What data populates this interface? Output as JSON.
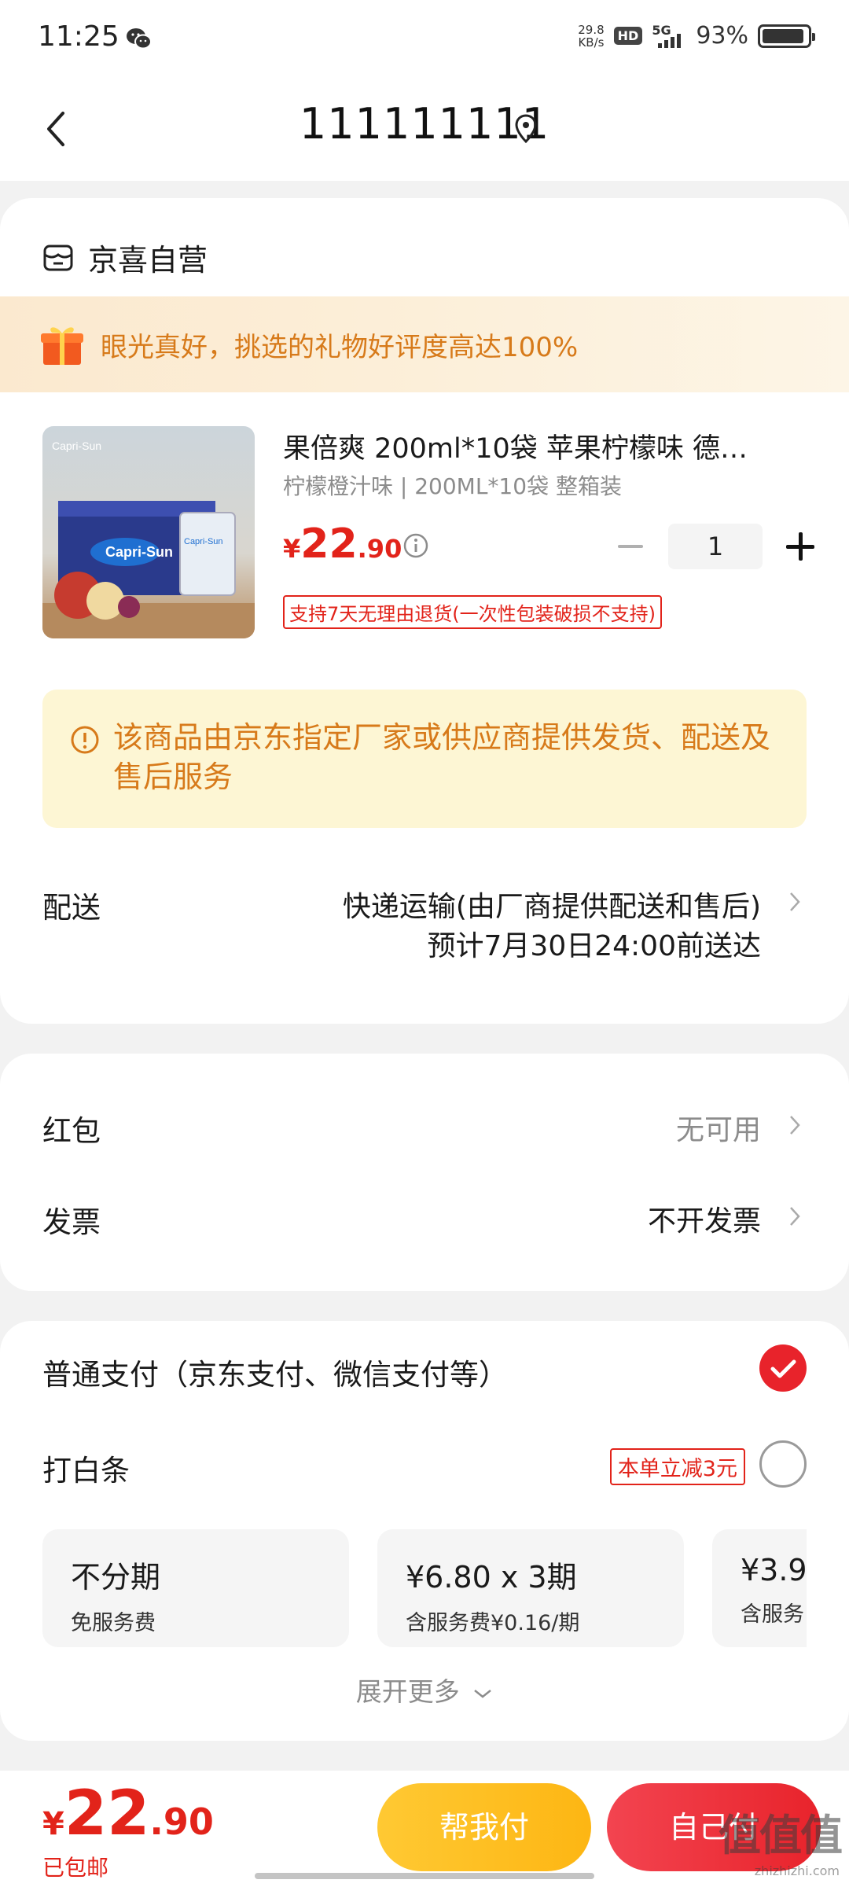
{
  "status_bar": {
    "time": "11:25",
    "net_speed_value": "29.8",
    "net_speed_unit": "KB/s",
    "hd_badge": "HD",
    "network_type": "5G",
    "battery_percent": "93%"
  },
  "nav": {
    "title": "111111111"
  },
  "store": {
    "name": "京喜自营"
  },
  "gift_banner": {
    "text": "眼光真好，挑选的礼物好评度高达100%"
  },
  "product": {
    "title": "果倍爽 200ml*10袋 苹果柠檬味 德…",
    "spec": "柠檬橙汁味 | 200ML*10袋 整箱装",
    "price_currency": "¥",
    "price_int": "22",
    "price_dec": ".90",
    "quantity": "1",
    "return_tag": "支持7天无理由退货(一次性包装破损不支持)"
  },
  "notice": {
    "text": "该商品由京东指定厂家或供应商提供发货、配送及售后服务"
  },
  "shipping": {
    "label": "配送",
    "method": "快递运输(由厂商提供配送和售后)",
    "eta": "预计7月30日24:00前送达"
  },
  "red_packet": {
    "label": "红包",
    "value": "无可用"
  },
  "invoice": {
    "label": "发票",
    "value": "不开发票"
  },
  "payment": {
    "normal_label": "普通支付（京东支付、微信支付等）",
    "baitiao_label": "打白条",
    "baitiao_discount": "本单立减3元",
    "plans": [
      {
        "title": "不分期",
        "sub": "免服务费"
      },
      {
        "title": "¥6.80 x 3期",
        "sub": "含服务费¥0.16/期"
      },
      {
        "title": "¥3.9",
        "sub": "含服务"
      }
    ],
    "expand_more": "展开更多"
  },
  "bottom_bar": {
    "total_currency": "¥",
    "total_int": "22",
    "total_dec": ".90",
    "shipping_note": "已包邮",
    "help_pay": "帮我付",
    "self_pay": "自己付",
    "watermark": "值值值",
    "watermark_domain": "zhizhizhi.com"
  },
  "colors": {
    "brand_red": "#e2231a",
    "gift_orange": "#d77a1a",
    "help_button_yellow": "#fdb613"
  }
}
